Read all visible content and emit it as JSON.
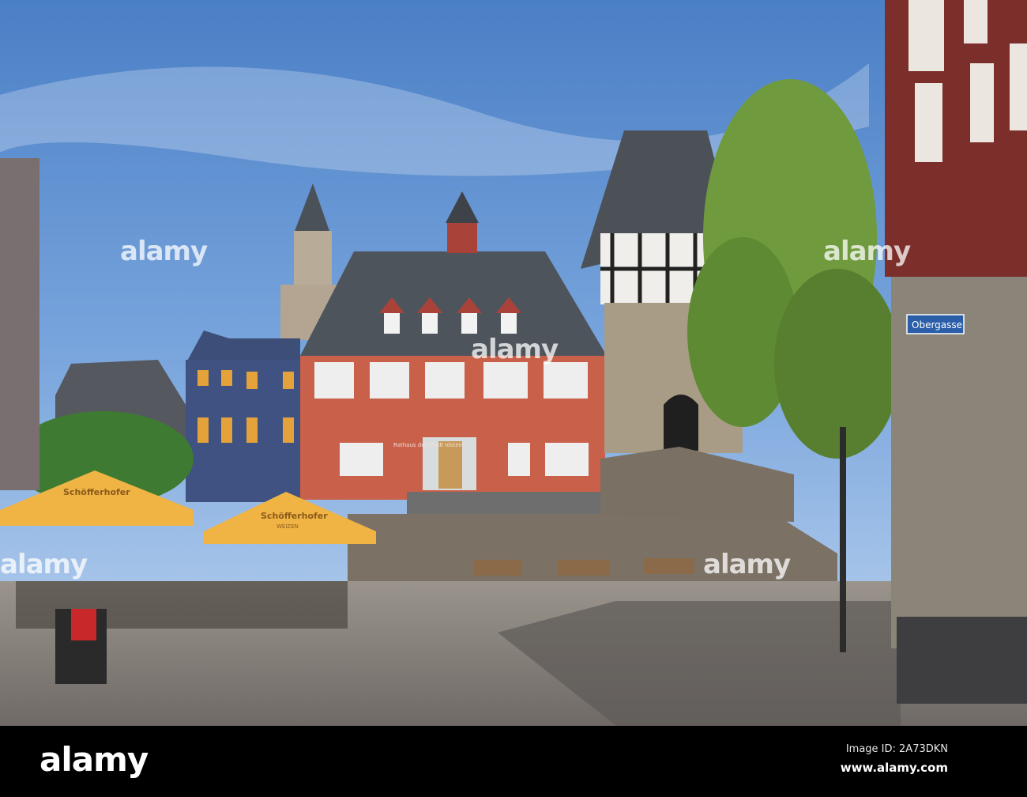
{
  "photo": {
    "subject": "Old town square",
    "signs": {
      "street_sign": "Obergasse",
      "town_hall_sign": "Rathaus der Stadt Idstein",
      "umbrella_brand": "Schöfferhofer",
      "umbrella_sub": "WEIZEN"
    },
    "colors": {
      "sky": "#5d8fd0",
      "town_hall": "#c9604a",
      "roof": "#4e545c",
      "ground": "#8a8580",
      "umbrella": "#f0b445"
    }
  },
  "watermark": {
    "logo": "alamy",
    "image_id": "Image ID: 2A73DKN",
    "site": "www.alamy.com",
    "overlay": "alamy"
  }
}
